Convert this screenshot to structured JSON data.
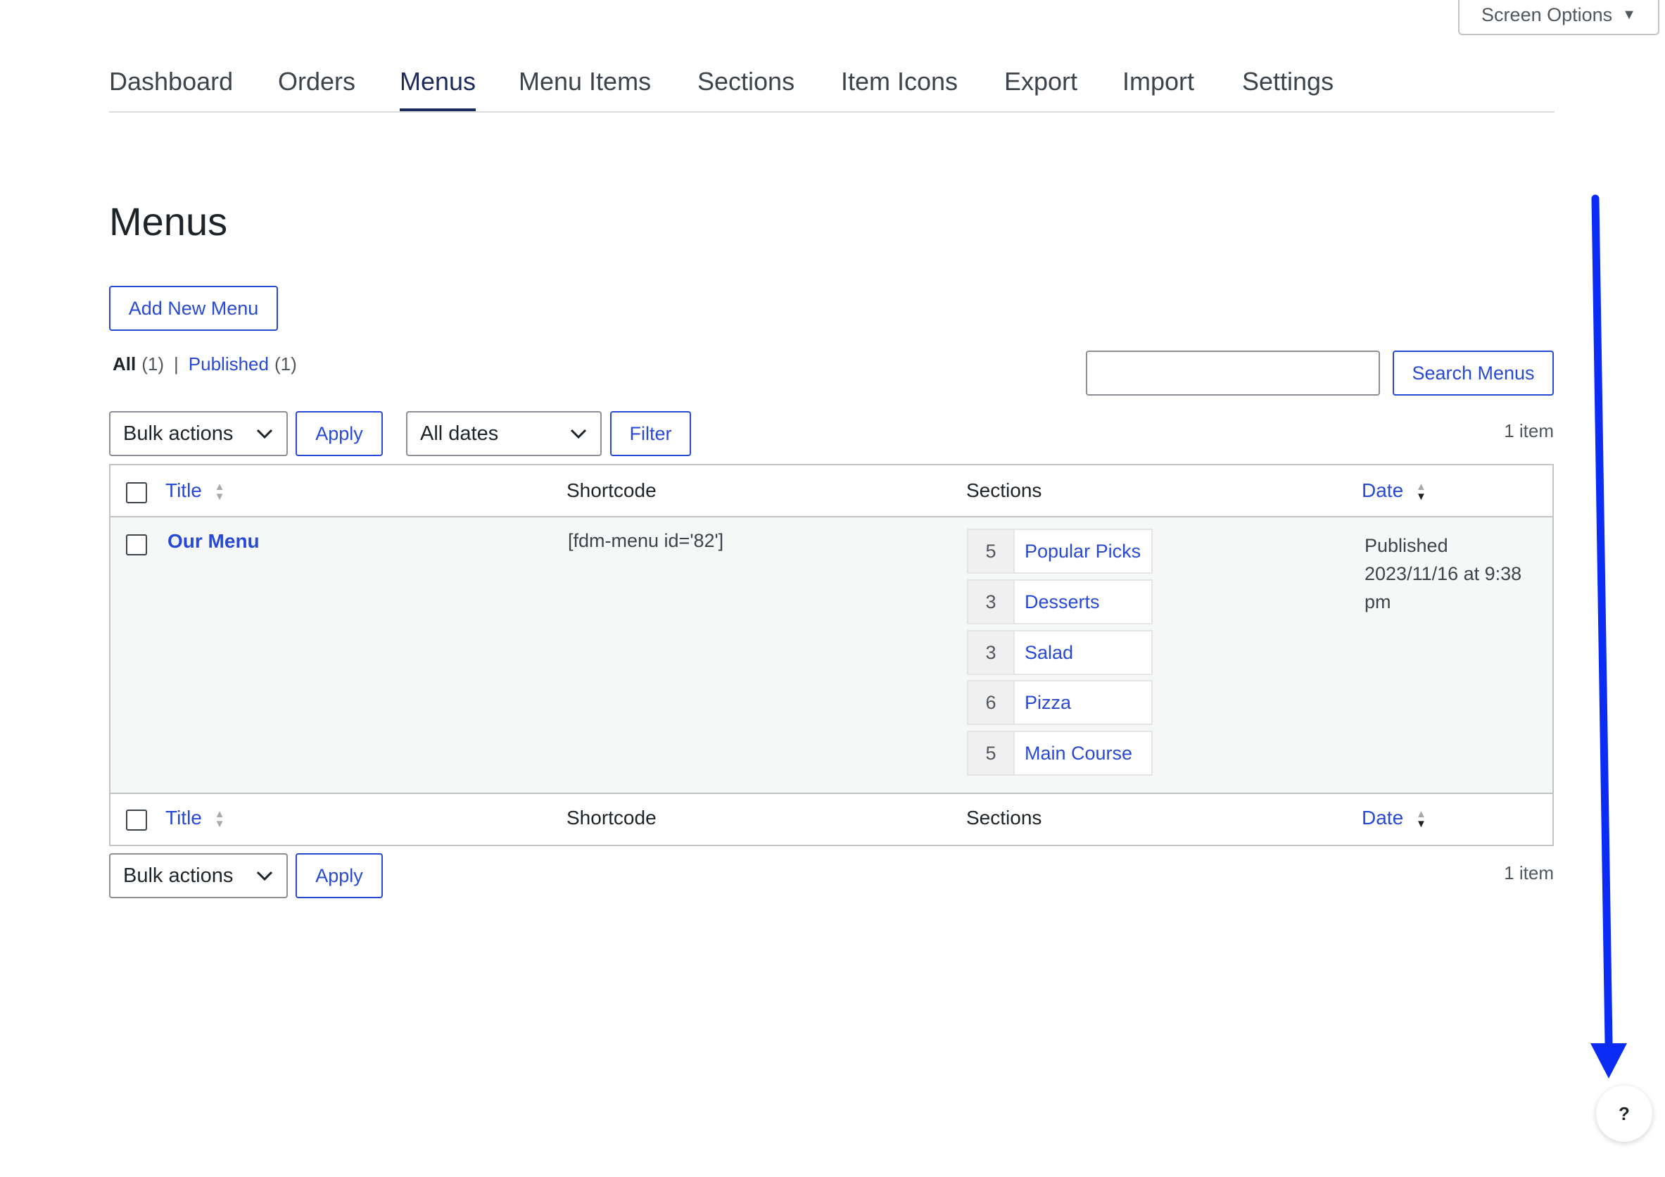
{
  "header": {
    "screen_options_label": "Screen Options",
    "screen_options_caret": "▼"
  },
  "nav": {
    "tabs": [
      {
        "label": "Dashboard"
      },
      {
        "label": "Orders"
      },
      {
        "label": "Menus",
        "active": true
      },
      {
        "label": "Menu Items"
      },
      {
        "label": "Sections"
      },
      {
        "label": "Item Icons"
      },
      {
        "label": "Export"
      },
      {
        "label": "Import"
      },
      {
        "label": "Settings"
      }
    ]
  },
  "page": {
    "title": "Menus",
    "add_new_label": "Add New Menu"
  },
  "filters": {
    "all_label": "All",
    "all_count": "(1)",
    "separator": "|",
    "published_label": "Published",
    "published_count": "(1)"
  },
  "search": {
    "value": "",
    "button_label": "Search Menus"
  },
  "toolbar_top": {
    "bulk_actions": "Bulk actions",
    "apply_label": "Apply",
    "dates": "All dates",
    "filter_label": "Filter",
    "count": "1 item"
  },
  "toolbar_bottom": {
    "bulk_actions": "Bulk actions",
    "apply_label": "Apply",
    "count": "1 item"
  },
  "table": {
    "columns": {
      "title": "Title",
      "shortcode": "Shortcode",
      "sections": "Sections",
      "date": "Date"
    },
    "rows": [
      {
        "title": "Our Menu",
        "shortcode": "[fdm-menu id='82']",
        "sections": [
          {
            "count": "5",
            "name": "Popular Picks"
          },
          {
            "count": "3",
            "name": "Desserts"
          },
          {
            "count": "3",
            "name": "Salad"
          },
          {
            "count": "6",
            "name": "Pizza"
          },
          {
            "count": "5",
            "name": "Main Course"
          }
        ],
        "date_status": "Published",
        "date_line1": "2023/11/16 at 9:38",
        "date_line2": "pm"
      }
    ]
  },
  "help": {
    "label": "?"
  },
  "colors": {
    "accent": "#2849d8",
    "annotation_arrow": "#0a2cf5",
    "active_tab": "#1d2b5c"
  }
}
